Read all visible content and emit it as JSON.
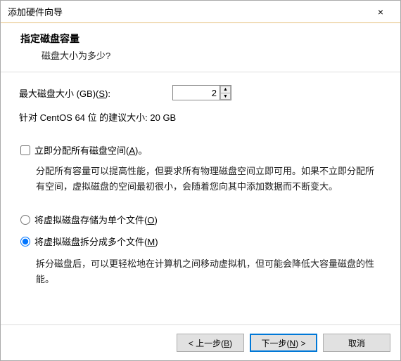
{
  "window": {
    "title": "添加硬件向导",
    "close": "×"
  },
  "header": {
    "title": "指定磁盘容量",
    "subtitle": "磁盘大小为多少?"
  },
  "size": {
    "label_pre": "最大磁盘大小 (GB)(",
    "label_key": "S",
    "label_post": "):",
    "value": "2"
  },
  "recommend": "针对 CentOS 64 位 的建议大小: 20 GB",
  "alloc": {
    "label_pre": "立即分配所有磁盘空间(",
    "label_key": "A",
    "label_post": ")。",
    "desc": "分配所有容量可以提高性能，但要求所有物理磁盘空间立即可用。如果不立即分配所有空间，虚拟磁盘的空间最初很小，会随着您向其中添加数据而不断变大。"
  },
  "store": {
    "single_pre": "将虚拟磁盘存储为单个文件(",
    "single_key": "O",
    "single_post": ")",
    "split_pre": "将虚拟磁盘拆分成多个文件(",
    "split_key": "M",
    "split_post": ")",
    "split_desc": "拆分磁盘后，可以更轻松地在计算机之间移动虚拟机，但可能会降低大容量磁盘的性能。"
  },
  "footer": {
    "back_pre": "< 上一步(",
    "back_key": "B",
    "back_post": ")",
    "next_pre": "下一步(",
    "next_key": "N",
    "next_post": ") >",
    "cancel": "取消"
  }
}
